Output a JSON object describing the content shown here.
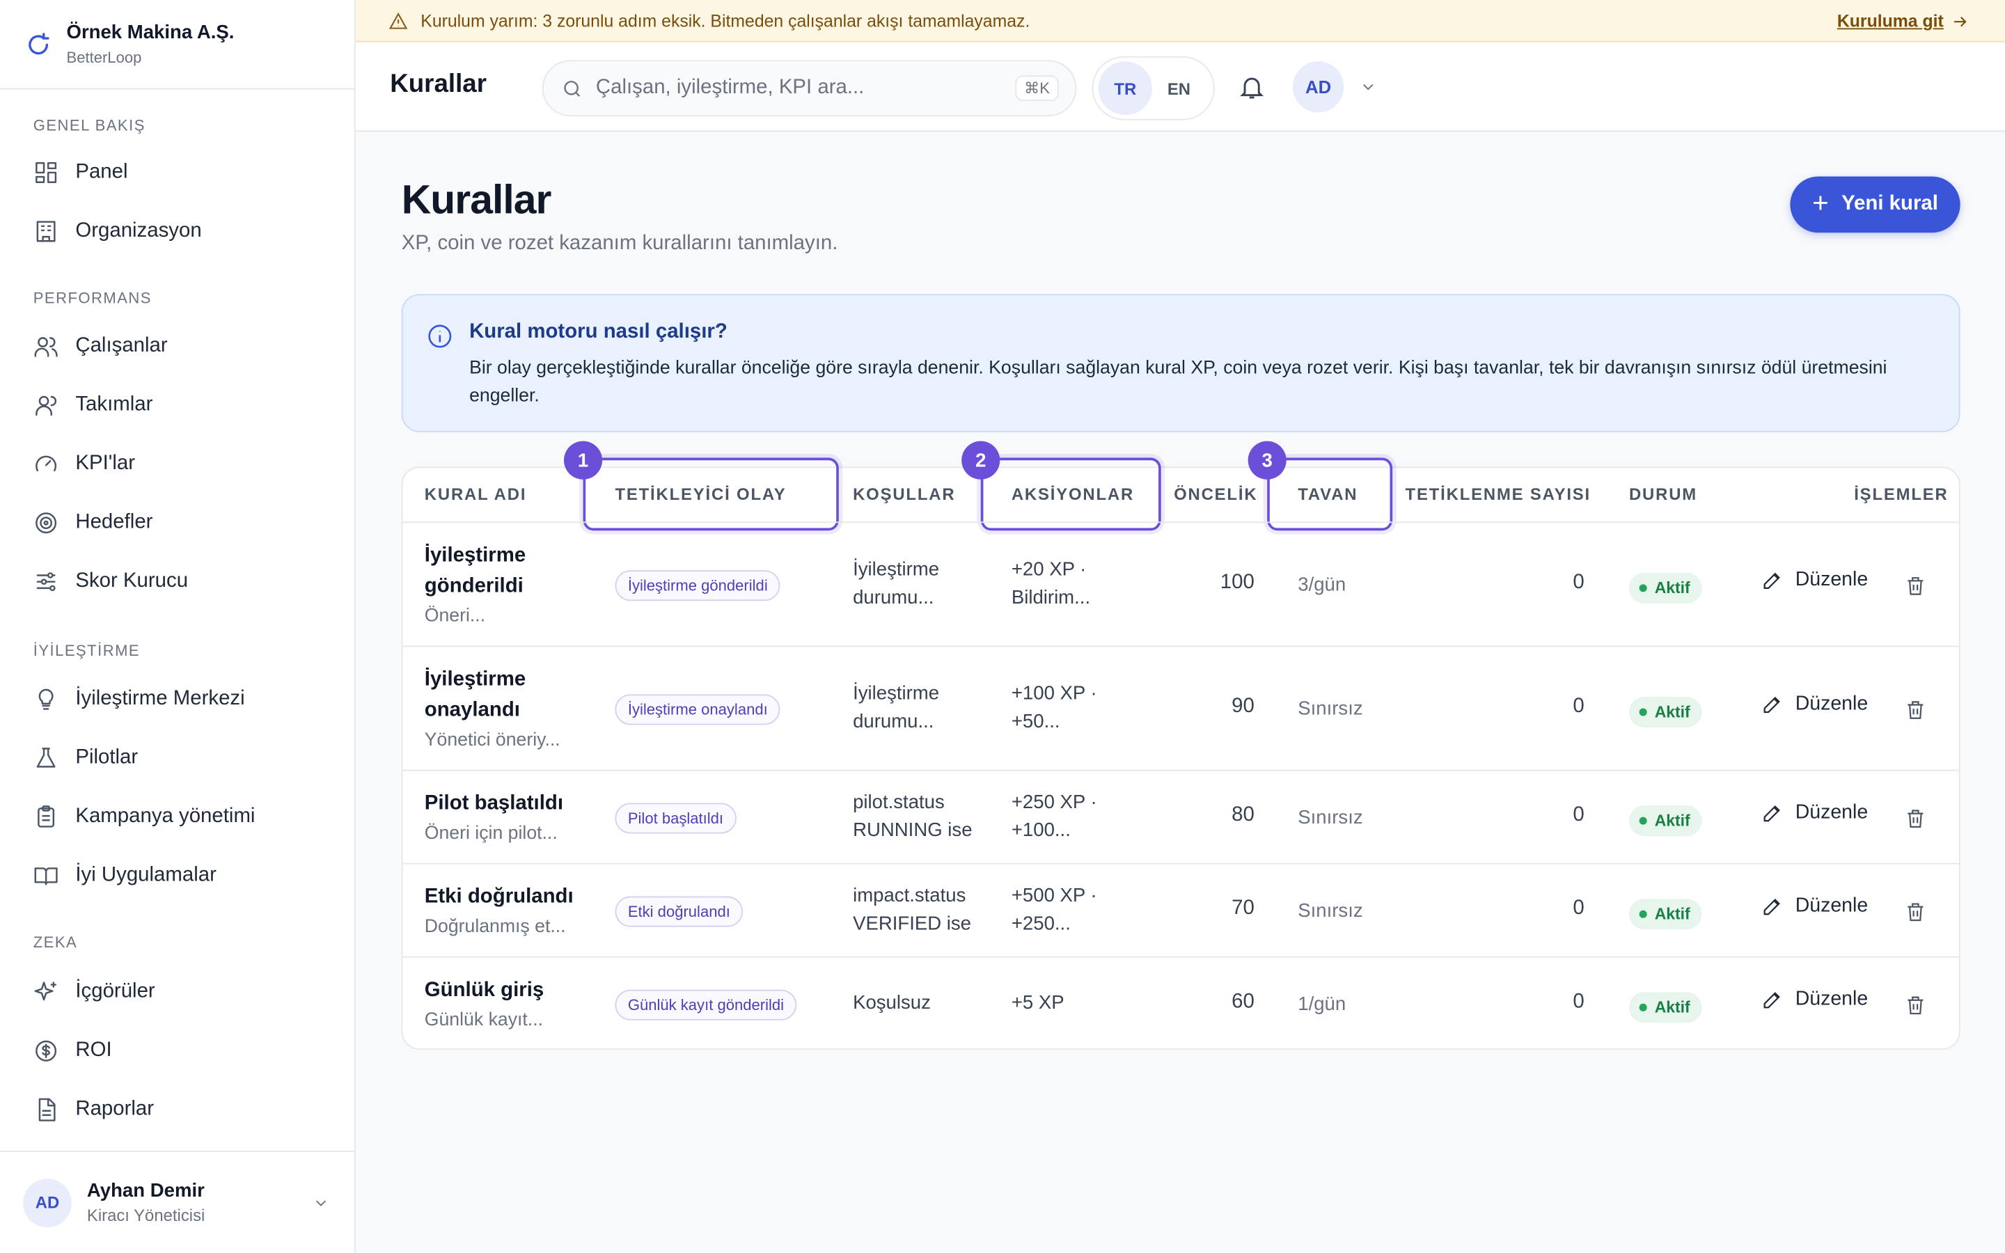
{
  "brand": {
    "name": "Örnek Makina A.Ş.",
    "sub": "BetterLoop"
  },
  "sidebar": {
    "sections": [
      {
        "label": "GENEL BAKIŞ",
        "items": [
          {
            "label": "Panel",
            "icon": "grid-icon"
          },
          {
            "label": "Organizasyon",
            "icon": "building-icon"
          }
        ]
      },
      {
        "label": "PERFORMANS",
        "items": [
          {
            "label": "Çalışanlar",
            "icon": "users-icon"
          },
          {
            "label": "Takımlar",
            "icon": "team-icon"
          },
          {
            "label": "KPI'lar",
            "icon": "gauge-icon"
          },
          {
            "label": "Hedefler",
            "icon": "target-icon"
          },
          {
            "label": "Skor Kurucu",
            "icon": "sliders-icon"
          }
        ]
      },
      {
        "label": "İYİLEŞTİRME",
        "items": [
          {
            "label": "İyileştirme Merkezi",
            "icon": "lightbulb-icon"
          },
          {
            "label": "Pilotlar",
            "icon": "flask-icon"
          },
          {
            "label": "Kampanya yönetimi",
            "icon": "clipboard-icon"
          },
          {
            "label": "İyi Uygulamalar",
            "icon": "book-icon"
          }
        ]
      },
      {
        "label": "ZEKA",
        "items": [
          {
            "label": "İçgörüler",
            "icon": "sparkles-icon"
          },
          {
            "label": "ROI",
            "icon": "dollar-icon"
          },
          {
            "label": "Raporlar",
            "icon": "file-icon"
          }
        ]
      }
    ]
  },
  "user": {
    "initials": "AD",
    "name": "Ayhan Demir",
    "role": "Kiracı Yöneticisi"
  },
  "banner": {
    "text": "Kurulum yarım: 3 zorunlu adım eksik. Bitmeden çalışanlar akışı tamamlayamaz.",
    "link": "Kuruluma git"
  },
  "topbar": {
    "title": "Kurallar",
    "search_placeholder": "Çalışan, iyileştirme, KPI ara...",
    "shortcut": "⌘K",
    "lang_tr": "TR",
    "lang_en": "EN",
    "avatar": "AD"
  },
  "page": {
    "title": "Kurallar",
    "subtitle": "XP, coin ve rozet kazanım kurallarını tanımlayın.",
    "new_button": "Yeni kural"
  },
  "info": {
    "title": "Kural motoru nasıl çalışır?",
    "text": "Bir olay gerçekleştiğinde kurallar önceliğe göre sırayla denenir. Koşulları sağlayan kural XP, coin veya rozet verir. Kişi başı tavanlar, tek bir davranışın sınırsız ödül üretmesini engeller."
  },
  "table": {
    "headers": {
      "name": "KURAL ADI",
      "trigger": "TETİKLEYİCİ OLAY",
      "conditions": "KOŞULLAR",
      "actions": "AKSİYONLAR",
      "priority": "ÖNCELİK",
      "cap": "TAVAN",
      "fired": "TETİKLENME SAYISI",
      "status": "DURUM",
      "ops": "İŞLEMLER"
    },
    "highlights": [
      "1",
      "2",
      "3"
    ],
    "edit_label": "Düzenle",
    "rows": [
      {
        "name1": "İyileştirme",
        "name2": "gönderildi",
        "sub": "Öneri...",
        "trigger": "İyileştirme gönderildi",
        "cond1": "İyileştirme",
        "cond2": "durumu...",
        "act1": "+20 XP ·",
        "act2": "Bildirim...",
        "priority": "100",
        "cap": "3/gün",
        "fired": "0",
        "status": "Aktif"
      },
      {
        "name1": "İyileştirme",
        "name2": "onaylandı",
        "sub": "Yönetici öneriy...",
        "trigger": "İyileştirme onaylandı",
        "cond1": "İyileştirme",
        "cond2": "durumu...",
        "act1": "+100 XP ·",
        "act2": "+50...",
        "priority": "90",
        "cap": "Sınırsız",
        "fired": "0",
        "status": "Aktif"
      },
      {
        "name1": "Pilot başlatıldı",
        "name2": "",
        "sub": "Öneri için pilot...",
        "trigger": "Pilot başlatıldı",
        "cond1": "pilot.status",
        "cond2": "RUNNING ise",
        "act1": "+250 XP ·",
        "act2": "+100...",
        "priority": "80",
        "cap": "Sınırsız",
        "fired": "0",
        "status": "Aktif"
      },
      {
        "name1": "Etki doğrulandı",
        "name2": "",
        "sub": "Doğrulanmış et...",
        "trigger": "Etki doğrulandı",
        "cond1": "impact.status",
        "cond2": "VERIFIED ise",
        "act1": "+500 XP ·",
        "act2": "+250...",
        "priority": "70",
        "cap": "Sınırsız",
        "fired": "0",
        "status": "Aktif"
      },
      {
        "name1": "Günlük giriş",
        "name2": "",
        "sub": "Günlük kayıt...",
        "trigger": "Günlük kayıt gönderildi",
        "cond1": "Koşulsuz",
        "cond2": "",
        "act1": "+5 XP",
        "act2": "",
        "priority": "60",
        "cap": "1/gün",
        "fired": "0",
        "status": "Aktif"
      }
    ]
  },
  "colors": {
    "accent": "#3b55d9",
    "highlight": "#6b4fd8",
    "active_green": "#1a7f45",
    "banner_bg": "#fdf6e3"
  }
}
